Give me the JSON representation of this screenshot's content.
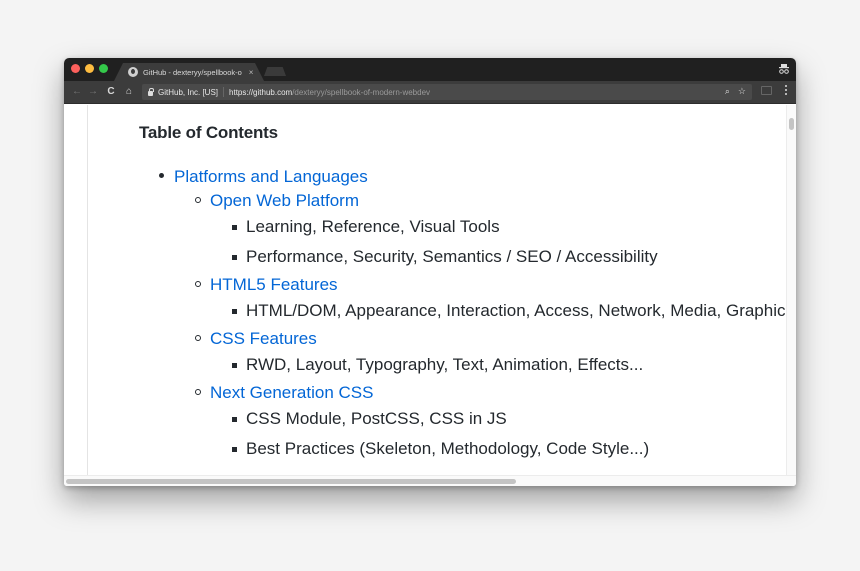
{
  "browser": {
    "tab": {
      "title": "GitHub - dexteryy/spellbook-o",
      "close": "×"
    },
    "traffic_lights": {
      "close": "#fc605c",
      "minimize": "#fdbc40",
      "zoom": "#34c84a"
    },
    "nav": {
      "back": "←",
      "forward": "→",
      "reload": "C",
      "home": "⌂"
    },
    "address_bar": {
      "ev_label": "GitHub, Inc. [US]",
      "url_scheme_host": "https://github.com",
      "url_path": "/dexteryy/spellbook-of-modern-webdev"
    },
    "icons": {
      "zoom": "⌕",
      "bookmark": "☆"
    }
  },
  "page": {
    "heading": "Table of Contents",
    "toc": [
      {
        "label": "Platforms and Languages",
        "children": [
          {
            "label": "Open Web Platform",
            "items": [
              "Learning, Reference, Visual Tools",
              "Performance, Security, Semantics / SEO / Accessibility"
            ]
          },
          {
            "label": "HTML5 Features",
            "items": [
              "HTML/DOM, Appearance, Interaction, Access, Network, Media, Graphics"
            ]
          },
          {
            "label": "CSS Features",
            "items": [
              "RWD, Layout, Typography, Text, Animation, Effects..."
            ]
          },
          {
            "label": "Next Generation CSS",
            "items": [
              "CSS Module, PostCSS, CSS in JS",
              "Best Practices (Skeleton, Methodology, Code Style...)"
            ]
          }
        ]
      }
    ]
  }
}
